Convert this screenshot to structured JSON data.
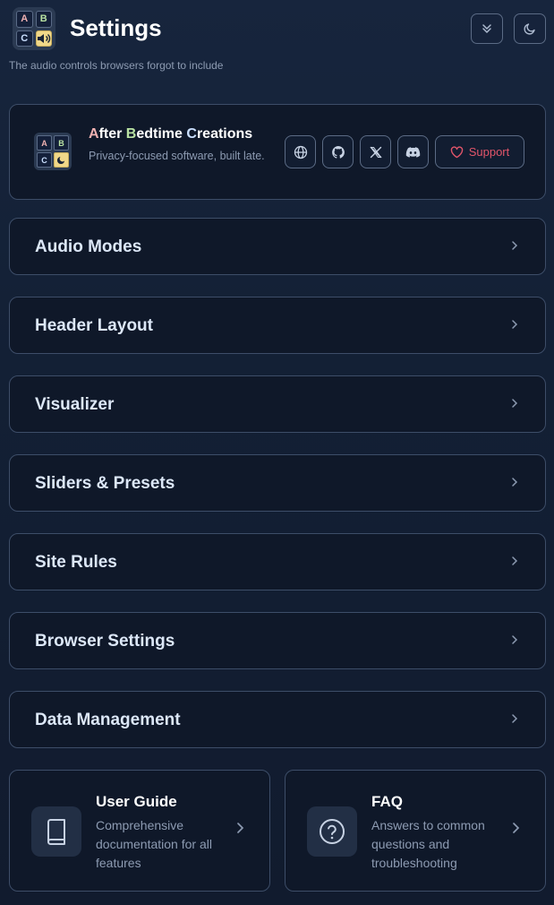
{
  "header": {
    "title": "Settings",
    "subtitle": "The audio controls browsers forgot to include",
    "logo_cells": [
      "A",
      "B",
      "C"
    ],
    "collapse_icon": "chevrons-down-icon",
    "theme_icon": "moon-icon"
  },
  "brand": {
    "name_parts": [
      "A",
      "fter ",
      "B",
      "edtime ",
      "C",
      "reations"
    ],
    "description": "Privacy-focused software, built late.",
    "logo_cells": [
      "A",
      "B",
      "C"
    ],
    "links": [
      "globe-icon",
      "github-icon",
      "x-icon",
      "discord-icon"
    ],
    "support_label": "Support"
  },
  "sections": [
    {
      "label": "Audio Modes"
    },
    {
      "label": "Header Layout"
    },
    {
      "label": "Visualizer"
    },
    {
      "label": "Sliders & Presets"
    },
    {
      "label": "Site Rules"
    },
    {
      "label": "Browser Settings"
    },
    {
      "label": "Data Management"
    }
  ],
  "bottom_cards": [
    {
      "title": "User Guide",
      "description": "Comprehensive documentation for all features",
      "icon": "book-icon"
    },
    {
      "title": "FAQ",
      "description": "Answers to common questions and troubleshooting",
      "icon": "help-circle-icon"
    }
  ],
  "colors": {
    "background": "#132035",
    "card": "#0f1829",
    "border": "#3d4d68",
    "accent_support": "#e2556a",
    "logo_speaker": "#f1d889"
  }
}
